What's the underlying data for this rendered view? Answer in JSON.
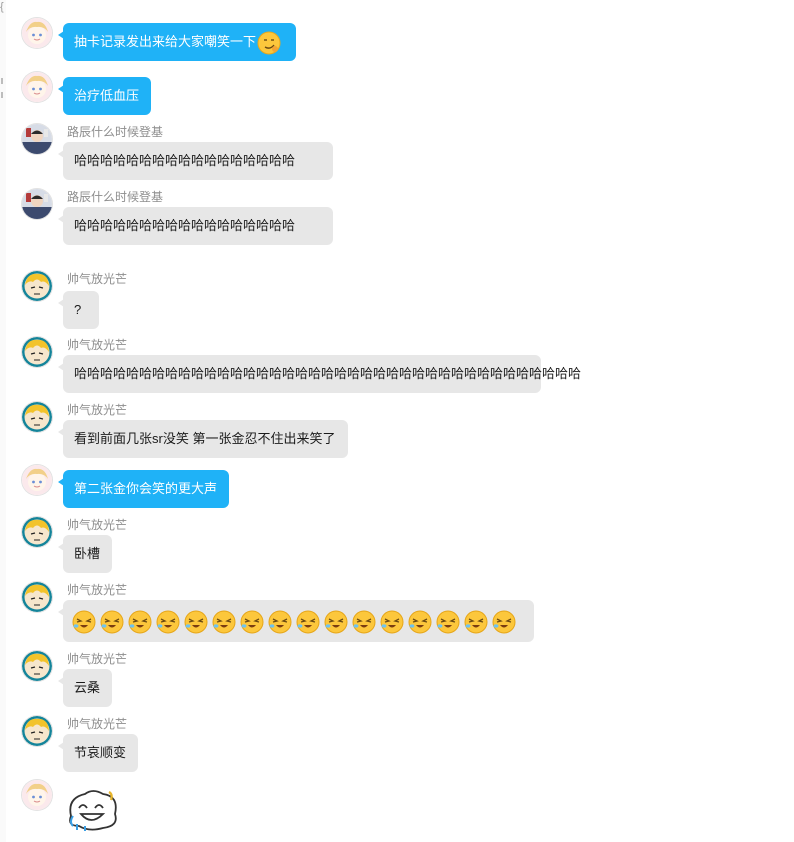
{
  "messages": [
    {
      "kind": "self",
      "text": "抽卡记录发出来给大家嘲笑一下",
      "emoji": "smirk"
    },
    {
      "kind": "self",
      "text": "治疗低血压"
    },
    {
      "kind": "other",
      "avatar": "luchen",
      "name": "路辰什么时候登基",
      "text": "哈哈哈哈哈哈哈哈哈哈哈哈哈哈哈哈哈"
    },
    {
      "kind": "other",
      "avatar": "luchen",
      "name": "路辰什么时候登基",
      "text": "哈哈哈哈哈哈哈哈哈哈哈哈哈哈哈哈哈"
    },
    {
      "kind": "other",
      "avatar": "shuaiqi",
      "name": "帅气放光芒",
      "text": "?"
    },
    {
      "kind": "other",
      "avatar": "shuaiqi",
      "name": "帅气放光芒",
      "text": "哈哈哈哈哈哈哈哈哈哈哈哈哈哈哈哈哈哈哈哈哈哈哈哈哈哈哈哈哈哈哈哈哈哈哈哈哈哈哈"
    },
    {
      "kind": "other",
      "avatar": "shuaiqi",
      "name": "帅气放光芒",
      "text": "看到前面几张sr没笑 第一张金忍不住出来笑了"
    },
    {
      "kind": "self",
      "text": "第二张金你会笑的更大声"
    },
    {
      "kind": "other",
      "avatar": "shuaiqi",
      "name": "帅气放光芒",
      "text": "卧槽"
    },
    {
      "kind": "other",
      "avatar": "shuaiqi",
      "name": "帅气放光芒",
      "text": "",
      "emoji_row": {
        "icon": "laugh-cry-sneeze",
        "count": 16
      }
    },
    {
      "kind": "other",
      "avatar": "shuaiqi",
      "name": "帅气放光芒",
      "text": "云桑"
    },
    {
      "kind": "other",
      "avatar": "shuaiqi",
      "name": "帅气放光芒",
      "text": "节哀顺变"
    },
    {
      "kind": "self",
      "text": "",
      "sticker": "laughing-face-sticker"
    }
  ],
  "colors": {
    "self_bubble": "#1fb2f7",
    "other_bubble": "#e7e7e7",
    "self_text": "#ffffff",
    "other_text": "#1a1a1a",
    "name_text": "#8e8e8e"
  }
}
